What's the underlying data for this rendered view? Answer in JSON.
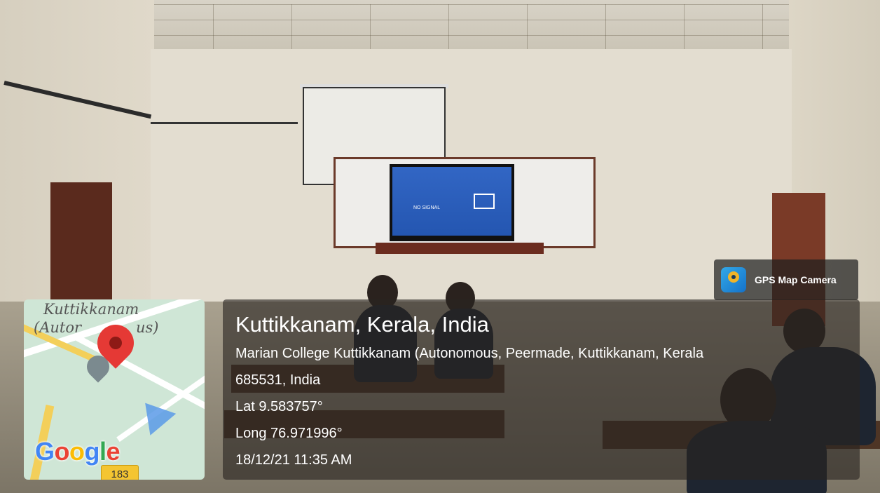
{
  "map": {
    "place_label_line1": "Kuttikkanam",
    "place_label_line2": "(Autor",
    "place_label_line2_suffix": "us)",
    "brand": "Google",
    "brand_letters": [
      "G",
      "o",
      "o",
      "g",
      "l",
      "e"
    ],
    "brand_colors": [
      "#4285F4",
      "#EA4335",
      "#FBBC05",
      "#4285F4",
      "#34A853",
      "#EA4335"
    ],
    "road_number": "183",
    "pin_color": "#e53935"
  },
  "badge": {
    "label": "GPS Map Camera",
    "icon": "map-pin-app-icon"
  },
  "location": {
    "title": "Kuttikkanam, Kerala, India",
    "address_line1": "Marian College Kuttikkanam (Autonomous, Peermade, Kuttikkanam, Kerala",
    "address_line2": "685531, India",
    "lat": "Lat 9.583757°",
    "long": "Long 76.971996°",
    "datetime": "18/12/21 11:35 AM"
  },
  "tv": {
    "message": "NO SIGNAL"
  }
}
